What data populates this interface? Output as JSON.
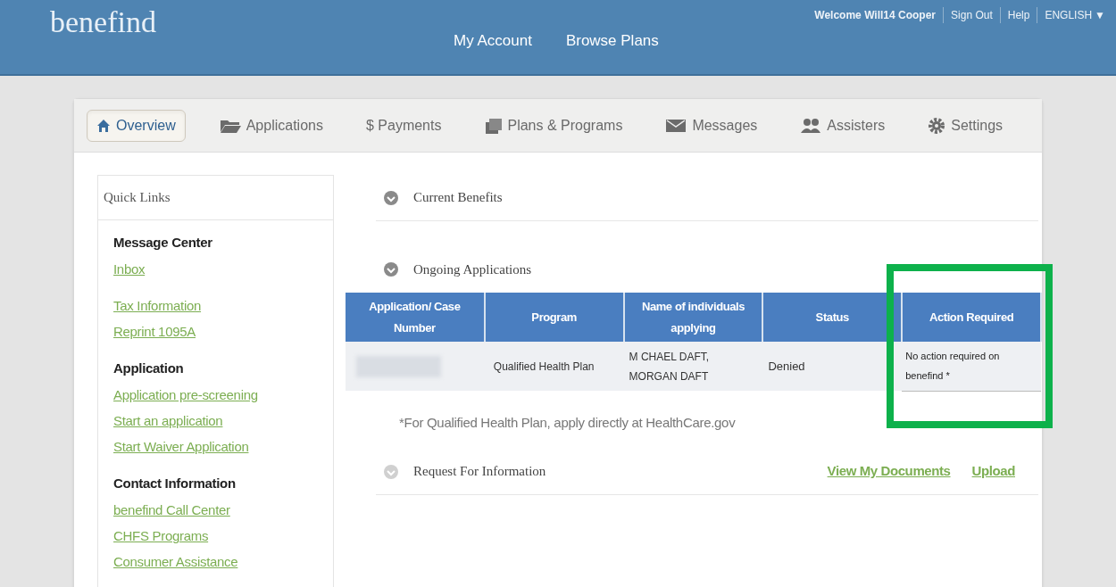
{
  "header": {
    "logo": "benefind",
    "nav": [
      "My Account",
      "Browse Plans"
    ],
    "user_links": [
      "Welcome Will14 Cooper",
      "Sign Out",
      "Help"
    ],
    "language": {
      "label": "ENGLISH",
      "caret": "▼"
    }
  },
  "tabs": [
    {
      "label": "Overview",
      "kind": "home",
      "selected": true
    },
    {
      "label": "Applications",
      "kind": "folder",
      "selected": false
    },
    {
      "label": "$ Payments",
      "kind": "plain",
      "selected": false
    },
    {
      "label": "Plans & Programs",
      "kind": "stack",
      "selected": false
    },
    {
      "label": "Messages",
      "kind": "envelope",
      "selected": false
    },
    {
      "label": "Assisters",
      "kind": "people",
      "selected": false
    },
    {
      "label": "Settings",
      "kind": "gear",
      "selected": false
    }
  ],
  "sidebar": {
    "title": "Quick Links",
    "groups": [
      {
        "heading": "Message Center",
        "links": [
          "Inbox"
        ]
      },
      {
        "links": [
          "Tax Information",
          "Reprint 1095A"
        ]
      },
      {
        "heading": "Application",
        "links": [
          "Application pre-screening",
          "Start an application",
          "Start Waiver Application"
        ]
      },
      {
        "heading": "Contact Information",
        "links": [
          "benefind Call Center",
          "CHFS Programs",
          "Consumer Assistance"
        ]
      }
    ]
  },
  "sections": [
    {
      "title": "Current Benefits",
      "enabled": true
    },
    {
      "title": "Ongoing Applications",
      "enabled": true
    }
  ],
  "table": {
    "columns": [
      "Application/ Case Number",
      "Program",
      "Name of individuals applying",
      "Status",
      "Action Required"
    ],
    "rows": [
      {
        "case_number_redacted": true,
        "program": "Qualified Health Plan",
        "names": [
          "M CHAEL DAFT,",
          "MORGAN DAFT"
        ],
        "status": "Denied",
        "action": "No action required on benefind *"
      }
    ]
  },
  "note": "*For Qualified Health Plan, apply directly at HealthCare.gov",
  "request": {
    "title": "Request For Information",
    "enabled": false,
    "links": [
      "View My Documents",
      "Upload"
    ]
  },
  "highlight": {
    "shown": true
  }
}
